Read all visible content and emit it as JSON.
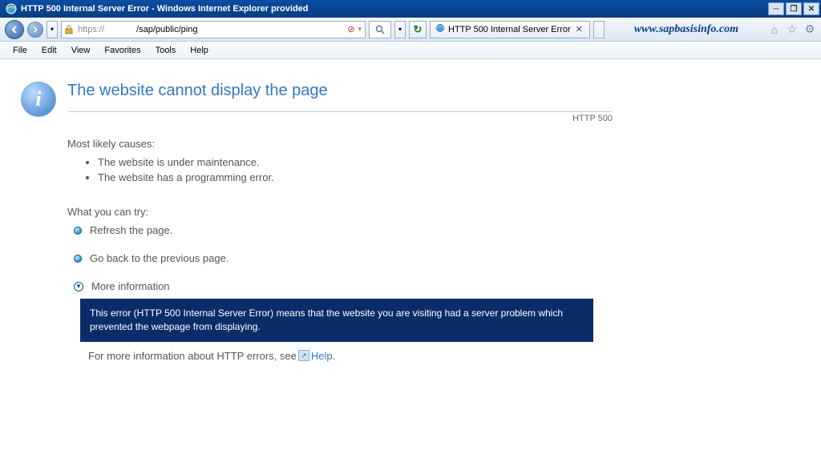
{
  "titlebar": {
    "text": "HTTP 500 Internal Server Error - Windows Internet Explorer provided"
  },
  "nav": {
    "protocol": "https://",
    "path": "/sap/public/ping",
    "tab_label": "HTTP 500 Internal Server Error",
    "brand": "www.sapbasisinfo.com"
  },
  "menu": {
    "file": "File",
    "edit": "Edit",
    "view": "View",
    "favorites": "Favorites",
    "tools": "Tools",
    "help": "Help"
  },
  "page": {
    "heading": "The website cannot display the page",
    "http_code": "HTTP 500",
    "causes_title": "Most likely causes:",
    "causes": [
      "The website is under maintenance.",
      "The website has a programming error."
    ],
    "try_title": "What you can try:",
    "try_refresh": "Refresh the page.",
    "try_back": "Go back to the previous page.",
    "more_info": "More information",
    "info_detail": "This error (HTTP 500 Internal Server Error) means that the website you are visiting had a server problem which prevented the webpage from displaying.",
    "help_prefix": "For more information about HTTP errors, see",
    "help_link": "Help."
  }
}
